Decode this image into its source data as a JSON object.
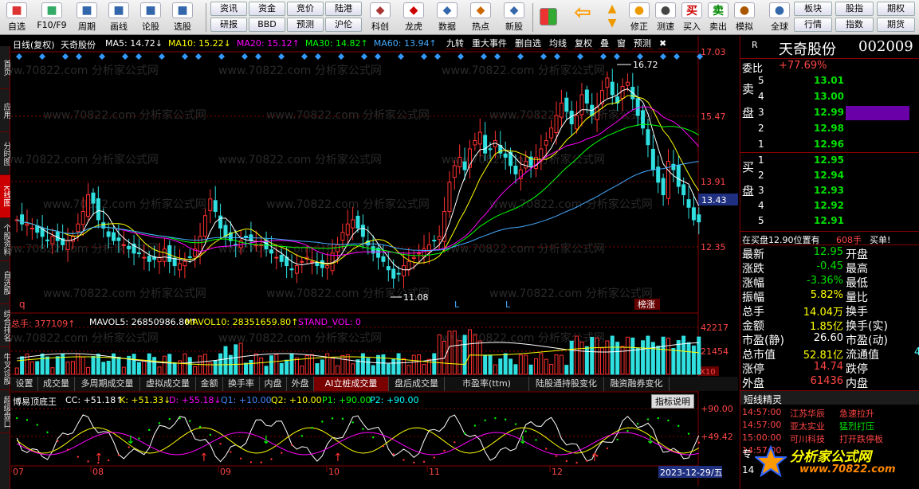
{
  "toolbar": {
    "items": [
      {
        "label": "自选",
        "icon": "star-icon",
        "color": "#d33"
      },
      {
        "label": "F10/F9",
        "icon": "f10-icon",
        "color": "#3a6"
      },
      {
        "label": "周期",
        "icon": "cycle-icon",
        "color": "#36a"
      },
      {
        "label": "画线",
        "icon": "pen-icon",
        "color": "#36a"
      },
      {
        "label": "论股",
        "icon": "discuss-icon",
        "color": "#36a"
      },
      {
        "label": "选股",
        "icon": "select-icon",
        "color": "#36a"
      }
    ],
    "grid_buttons": [
      "资讯",
      "资金",
      "竞价",
      "陆港",
      "研报",
      "BBD",
      "预测",
      "沪伦"
    ],
    "items2": [
      {
        "label": "科创",
        "icon": "sci-icon",
        "color": "#a33"
      },
      {
        "label": "龙虎",
        "icon": "dragon-icon",
        "color": "#c00"
      },
      {
        "label": "数据",
        "icon": "pe-icon",
        "color": "#36a"
      },
      {
        "label": "热点",
        "icon": "hot-icon",
        "color": "#c60"
      },
      {
        "label": "新股",
        "icon": "newstock-icon",
        "color": "#36a"
      }
    ],
    "items3": [
      {
        "label": "后退",
        "icon": "back-icon",
        "color": "#e90"
      },
      {
        "label": "修正",
        "icon": "fix-icon",
        "color": "#e90"
      },
      {
        "label": "测速",
        "icon": "speed-icon",
        "color": "#444"
      },
      {
        "label": "买入",
        "icon": "buy-icon",
        "color": "#c00"
      },
      {
        "label": "卖出",
        "icon": "sell-icon",
        "color": "#080"
      },
      {
        "label": "模拟",
        "icon": "hammer-icon",
        "color": "#a50"
      },
      {
        "label": "全球",
        "icon": "globe-icon",
        "color": "#36a"
      }
    ],
    "right_buttons": [
      "板块",
      "股指",
      "期权",
      "行情",
      "指数",
      "期货"
    ]
  },
  "leftnav": [
    "首页",
    "应用",
    "分时图",
    "K线图",
    "个股资料",
    "自选股",
    "综合排名",
    "牛叉诊股",
    "超级盘口"
  ],
  "chart": {
    "title": "日线(复权)",
    "name": "天奇股份",
    "ma": [
      {
        "t": "MA5: 14.72↓",
        "c": "#fff"
      },
      {
        "t": "MA10: 15.22↓",
        "c": "#ff0"
      },
      {
        "t": "MA20: 15.12↑",
        "c": "#f0f"
      },
      {
        "t": "MA30: 14.82↑",
        "c": "#0f0"
      },
      {
        "t": "MA60: 13.94↑",
        "c": "#4af"
      }
    ],
    "top_buttons": [
      "九转",
      "重大事件",
      "删自选",
      "均线",
      "复权",
      "叠",
      "窗",
      "预测",
      "✖"
    ],
    "price_axis": [
      "17.03",
      "15.47",
      "13.91",
      "12.35"
    ],
    "current_price": "13.43",
    "high_label": "16.72",
    "low_label": "11.08",
    "markers": [
      "L",
      "L"
    ],
    "q_label": "q",
    "rank_badge": "榜涨",
    "vol": {
      "label": "总手: 377109↑",
      "mavol5": "MAVOL5: 26850986.80↑",
      "mavol10": "MAVOL10: 28351659.80↑",
      "stand": "STAND_VOL: 0",
      "axis": [
        "42217",
        "21454"
      ],
      "unit": "X10"
    },
    "tabs": [
      "设置",
      "成交量",
      "多周期成交量",
      "虚拟成交量",
      "金额",
      "换手率",
      "内盘",
      "外盘",
      "AI立桩成交量",
      "盘后成交量",
      "市盈率(ttm)",
      "陆股通持股变化",
      "融资融券变化"
    ],
    "active_tab": "AI立桩成交量",
    "ind": {
      "name": "博易顶底王",
      "cc": "CC: +51.18↑",
      "k": "K: +51.33↓",
      "d": "D: +55.18↓",
      "q1": "Q1: +10.00",
      "q2": "Q2: +10.00",
      "p1": "P1: +90.00",
      "p2": "P2: +90.00",
      "help": "指标说明",
      "axis": [
        "+90.00",
        "+49.42"
      ]
    },
    "months": [
      "07",
      "08",
      "09",
      "10",
      "11",
      "12"
    ],
    "date_badge": "2023-12-29/五",
    "watermark": "www.70822.com 分析家公式网"
  },
  "panel": {
    "r": "R",
    "name": "天奇股份",
    "code": "002009",
    "wb_label": "委比",
    "wb": "+77.69%",
    "sell_label": "卖盘",
    "buy_label": "买盘",
    "asks": [
      {
        "n": "5",
        "p": "13.01"
      },
      {
        "n": "4",
        "p": "13.00"
      },
      {
        "n": "3",
        "p": "12.99"
      },
      {
        "n": "2",
        "p": "12.98"
      },
      {
        "n": "1",
        "p": "12.96"
      }
    ],
    "bids": [
      {
        "n": "1",
        "p": "12.95"
      },
      {
        "n": "2",
        "p": "12.94"
      },
      {
        "n": "3",
        "p": "12.93"
      },
      {
        "n": "4",
        "p": "12.92"
      },
      {
        "n": "5",
        "p": "12.91"
      }
    ],
    "notice": "在买盘12.90位置有",
    "notice_vol": "608手",
    "notice_type": "买单!",
    "stats": [
      {
        "a": "最新",
        "av": "12.95",
        "ac": "grn",
        "b": "开盘",
        "bv": ""
      },
      {
        "a": "涨跌",
        "av": "-0.45",
        "ac": "grn",
        "b": "最高",
        "bv": ""
      },
      {
        "a": "涨幅",
        "av": "-3.36%",
        "ac": "grn",
        "b": "最低",
        "bv": ""
      },
      {
        "a": "振幅",
        "av": "5.82%",
        "ac": "yel",
        "b": "量比",
        "bv": ""
      },
      {
        "a": "总手",
        "av": "14.04万",
        "ac": "yel",
        "b": "换手",
        "bv": ""
      },
      {
        "a": "金额",
        "av": "1.85亿",
        "ac": "yel",
        "b": "换手(实)",
        "bv": ""
      },
      {
        "a": "市盈(静)",
        "av": "26.60",
        "ac": "wht",
        "b": "市盈(动)",
        "bv": ""
      },
      {
        "a": "总市值",
        "av": "52.81亿",
        "ac": "yel",
        "b": "流通值",
        "bv": "4"
      },
      {
        "a": "涨停",
        "av": "14.74",
        "ac": "red",
        "b": "跌停",
        "bv": ""
      },
      {
        "a": "外盘",
        "av": "61436",
        "ac": "red",
        "b": "内盘",
        "bv": ""
      }
    ],
    "sprite_title": "短线精灵",
    "sprites": [
      {
        "t": "14:57:00",
        "s": "江苏华辰",
        "e": "急速拉升",
        "ec": "red"
      },
      {
        "t": "14:57:00",
        "s": "亚太实业",
        "e": "猛烈打压",
        "ec": "grn"
      },
      {
        "t": "15:00:00",
        "s": "可川科技",
        "e": "打开跌停板",
        "ec": "red"
      },
      {
        "t": "14:57:00",
        "s": "",
        "e": "",
        "ec": "red"
      }
    ],
    "logo_text": "分析家公式网",
    "logo_url": "www.70822.com",
    "bottom_left": "专",
    "bottom_num": "14"
  }
}
